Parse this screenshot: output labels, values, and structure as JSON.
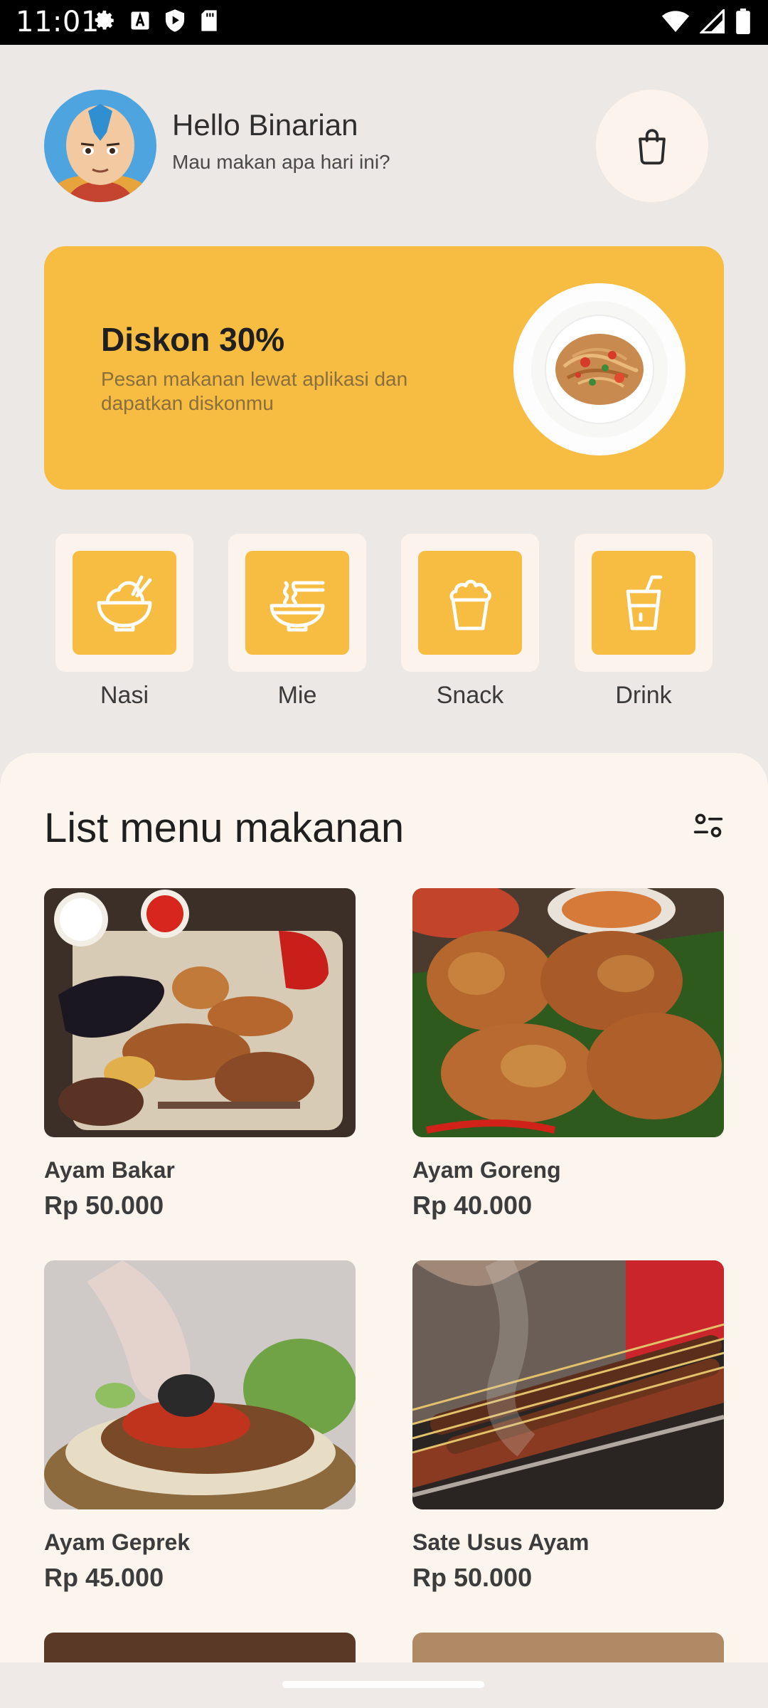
{
  "status_bar": {
    "time": "11:01"
  },
  "header": {
    "greeting": "Hello Binarian",
    "subtitle": "Mau makan apa hari ini?"
  },
  "promo": {
    "title": "Diskon 30%",
    "description": "Pesan makanan lewat aplikasi dan dapatkan diskonmu"
  },
  "categories": [
    {
      "label": "Nasi",
      "icon": "rice-bowl-icon"
    },
    {
      "label": "Mie",
      "icon": "noodle-bowl-icon"
    },
    {
      "label": "Snack",
      "icon": "popcorn-icon"
    },
    {
      "label": "Drink",
      "icon": "drink-cup-icon"
    }
  ],
  "menu": {
    "title": "List menu makanan",
    "items": [
      {
        "name": "Ayam Bakar",
        "price": "Rp 50.000"
      },
      {
        "name": "Ayam Goreng",
        "price": "Rp 40.000"
      },
      {
        "name": "Ayam Geprek",
        "price": "Rp 45.000"
      },
      {
        "name": "Sate Usus Ayam",
        "price": "Rp 50.000"
      }
    ]
  },
  "colors": {
    "accent": "#F7BD43",
    "background": "#ECE8E5",
    "card": "#FCF5ED"
  }
}
